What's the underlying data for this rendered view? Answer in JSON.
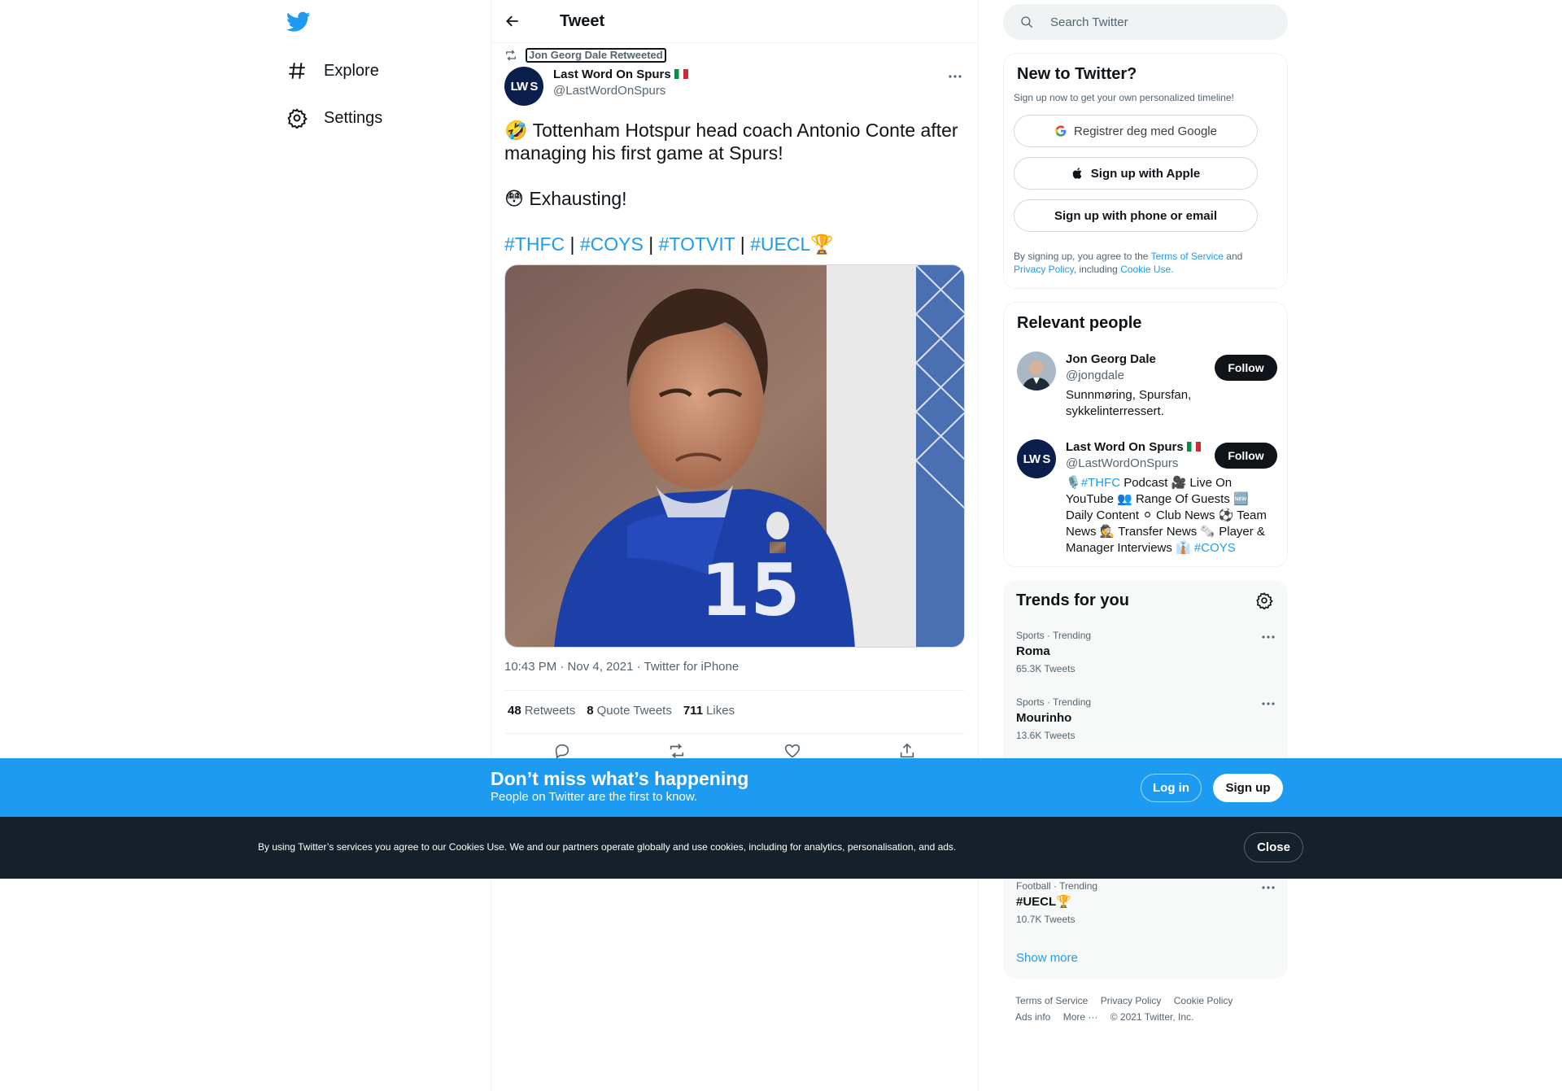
{
  "nav": {
    "explore": "Explore",
    "settings": "Settings"
  },
  "header": {
    "title": "Tweet"
  },
  "tweet": {
    "retweeted_by": "Jon Georg Dale Retweeted",
    "author_name": "Last Word On Spurs",
    "author_handle": "@LastWordOnSpurs",
    "avatar_text": "LW S",
    "line1_emoji": "🤣",
    "line1": "Tottenham Hotspur head coach Antonio Conte after managing his first game at Spurs!",
    "line2_emoji": "😳",
    "line2": "Exhausting!",
    "hashtags": [
      "#THFC",
      "#COYS",
      "#TOTVIT",
      "#UECL"
    ],
    "hashtag_sep": "|",
    "trophy_emoji": "🏆",
    "meta": "10:43 PM · Nov 4, 2021 · Twitter for iPhone",
    "retweets": "48",
    "retweets_label": "Retweets",
    "quotes": "8",
    "quotes_label": "Quote Tweets",
    "likes": "711",
    "likes_label": "Likes",
    "photo_number": "15"
  },
  "search": {
    "placeholder": "Search Twitter"
  },
  "signup": {
    "title": "New to Twitter?",
    "subtitle": "Sign up now to get your own personalized timeline!",
    "google": "Registrer deg med Google",
    "apple": "Sign up with Apple",
    "phone": "Sign up with phone or email",
    "legal_1": "By signing up, you agree to the",
    "tos": "Terms of Service",
    "and": "and",
    "privacy": "Privacy Policy",
    "including": ", including",
    "cookie_use": "Cookie Use."
  },
  "people": {
    "title": "Relevant people",
    "list": [
      {
        "name": "Jon Georg Dale",
        "handle": "@jongdale",
        "bio": "Sunnmøring, Spursfan, sykkelinterressert.",
        "follow": "Follow"
      },
      {
        "name": "Last Word On Spurs",
        "handle": "@LastWordOnSpurs",
        "bio_1": "🎙️",
        "bio_tag1": "#THFC",
        "bio_2": "Podcast 🎥 Live On YouTube 👥 Range Of Guests 🆕 Daily Content ⚪ Club News ⚽ Team News 🕵️ Transfer News 🗞️ Player & Manager Interviews 👔",
        "bio_tag2": "#COYS",
        "follow": "Follow"
      }
    ]
  },
  "trends": {
    "title": "Trends for you",
    "items": [
      {
        "context": "Sports · Trending",
        "name": "Roma",
        "count": "65.3K Tweets"
      },
      {
        "context": "Sports · Trending",
        "name": "Mourinho",
        "count": "13.6K Tweets"
      },
      {
        "context": "Football · Trending",
        "name": "#UECL🏆",
        "count": "10.7K Tweets"
      }
    ],
    "show_more": "Show more"
  },
  "footer": {
    "links": [
      "Terms of Service",
      "Privacy Policy",
      "Cookie Policy",
      "Ads info",
      "More ···",
      "© 2021 Twitter, Inc."
    ]
  },
  "banner": {
    "title": "Don’t miss what’s happening",
    "subtitle": "People on Twitter are the first to know.",
    "login": "Log in",
    "signup": "Sign up"
  },
  "cookie": {
    "text": "By using Twitter’s services you agree to our Cookies Use. We and our partners operate globally and use cookies, including for analytics, personalisation, and ads.",
    "close": "Close"
  },
  "colors": {
    "accent": "#1d9bf0",
    "text": "#0f1419",
    "muted": "#536471",
    "cookie_bg": "#15202b"
  }
}
